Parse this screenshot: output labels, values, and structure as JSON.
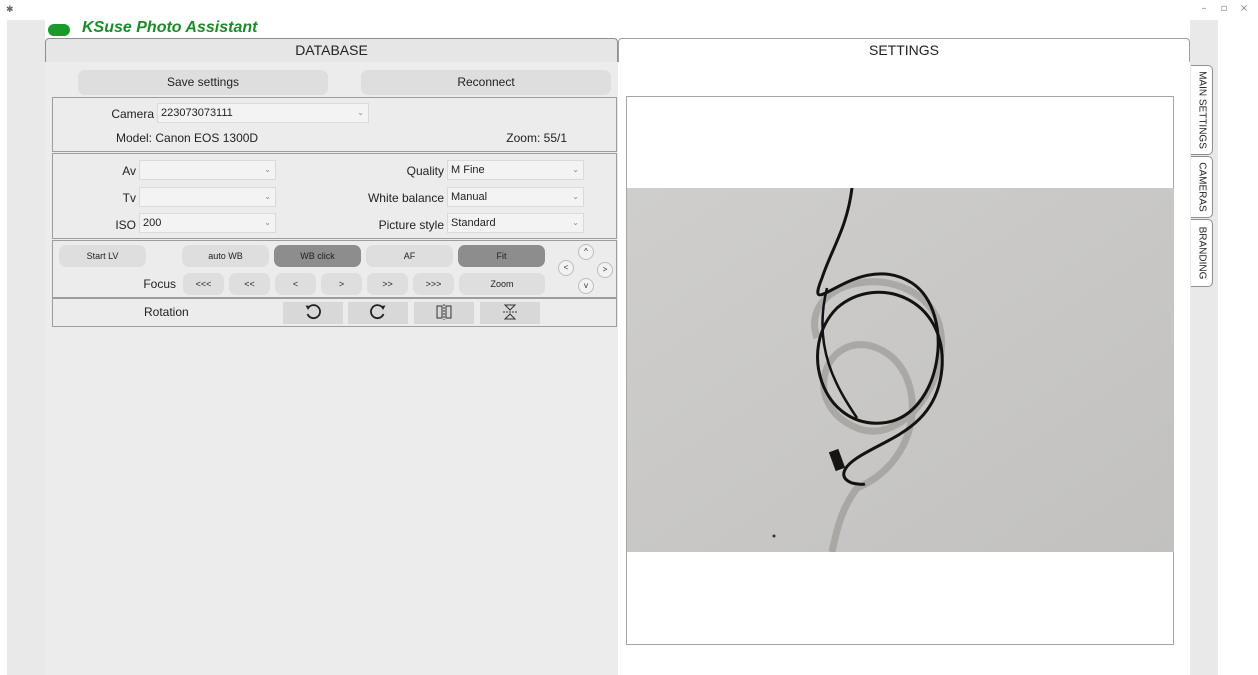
{
  "app": {
    "title": "KSuse Photo Assistant",
    "brand_color": "#1f8a2c"
  },
  "window": {
    "icon": "app-icon",
    "controls": {
      "minimize": "–",
      "maximize": "▫",
      "close": "×"
    }
  },
  "tabs": {
    "database": "DATABASE",
    "settings": "SETTINGS",
    "active": "SETTINGS"
  },
  "side_tabs": [
    "MAIN SETTINGS",
    "CAMERAS",
    "BRANDING"
  ],
  "toolbar": {
    "save_label": "Save settings",
    "reconnect_label": "Reconnect"
  },
  "camera": {
    "label": "Camera",
    "value": "223073073111",
    "model": "Model: Canon EOS 1300D",
    "zoom": "Zoom: 55/1"
  },
  "exposure": {
    "av_label": "Av",
    "av_value": "",
    "tv_label": "Tv",
    "tv_value": "",
    "iso_label": "ISO",
    "iso_value": "200",
    "quality_label": "Quality",
    "quality_value": "M Fine",
    "wb_label": "White balance",
    "wb_value": "Manual",
    "style_label": "Picture style",
    "style_value": "Standard"
  },
  "liveview": {
    "start_lv": "Start LV",
    "auto_wb": "auto WB",
    "wb_click": "WB click",
    "af": "AF",
    "fit": "Fit",
    "focus_label": "Focus",
    "focus_buttons": [
      "<<<",
      "<<",
      "<",
      ">",
      ">>",
      ">>>"
    ],
    "zoom": "Zoom",
    "nav": {
      "up": "^",
      "left": "<",
      "right": ">",
      "down": "v"
    }
  },
  "rotation": {
    "label": "Rotation",
    "icons": [
      "rotate-ccw-icon",
      "rotate-cw-icon",
      "flip-horizontal-icon",
      "flip-vertical-icon"
    ]
  },
  "colors": {
    "accent_green": "#1a9a2a",
    "button_gray": "#dedede",
    "button_dark": "#8d8d8d"
  }
}
